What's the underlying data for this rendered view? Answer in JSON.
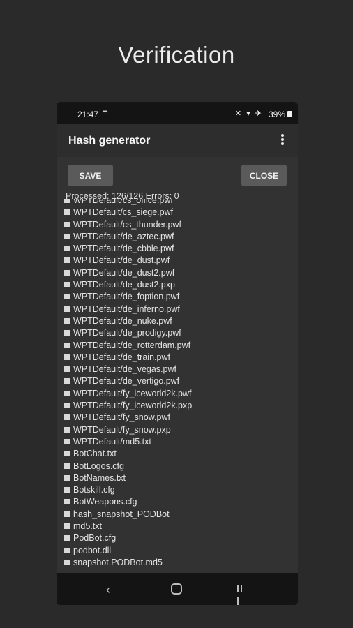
{
  "promo": {
    "title": "Verification"
  },
  "status_bar": {
    "time": "21:47",
    "dots": "▪▪",
    "icons": "✕ ▾ ✈",
    "battery": "39%"
  },
  "app_bar": {
    "title": "Hash generator"
  },
  "toolbar": {
    "save_label": "SAVE",
    "close_label": "CLOSE"
  },
  "summary": {
    "text": "Processed: 126/126 Errors: 0"
  },
  "files": [
    "WPTDefault/cs_office.pwf",
    "WPTDefault/cs_siege.pwf",
    "WPTDefault/cs_thunder.pwf",
    "WPTDefault/de_aztec.pwf",
    "WPTDefault/de_cbble.pwf",
    "WPTDefault/de_dust.pwf",
    "WPTDefault/de_dust2.pwf",
    "WPTDefault/de_dust2.pxp",
    "WPTDefault/de_foption.pwf",
    "WPTDefault/de_inferno.pwf",
    "WPTDefault/de_nuke.pwf",
    "WPTDefault/de_prodigy.pwf",
    "WPTDefault/de_rotterdam.pwf",
    "WPTDefault/de_train.pwf",
    "WPTDefault/de_vegas.pwf",
    "WPTDefault/de_vertigo.pwf",
    "WPTDefault/fy_iceworld2k.pwf",
    "WPTDefault/fy_iceworld2k.pxp",
    "WPTDefault/fy_snow.pwf",
    "WPTDefault/fy_snow.pxp",
    "WPTDefault/md5.txt",
    "BotChat.txt",
    "BotLogos.cfg",
    "BotNames.txt",
    "Botskill.cfg",
    "BotWeapons.cfg",
    "hash_snapshot_PODBot",
    "md5.txt",
    "PodBot.cfg",
    "podbot.dll",
    "snapshot.PODBot.md5"
  ],
  "nav": {
    "back_glyph": "‹"
  }
}
